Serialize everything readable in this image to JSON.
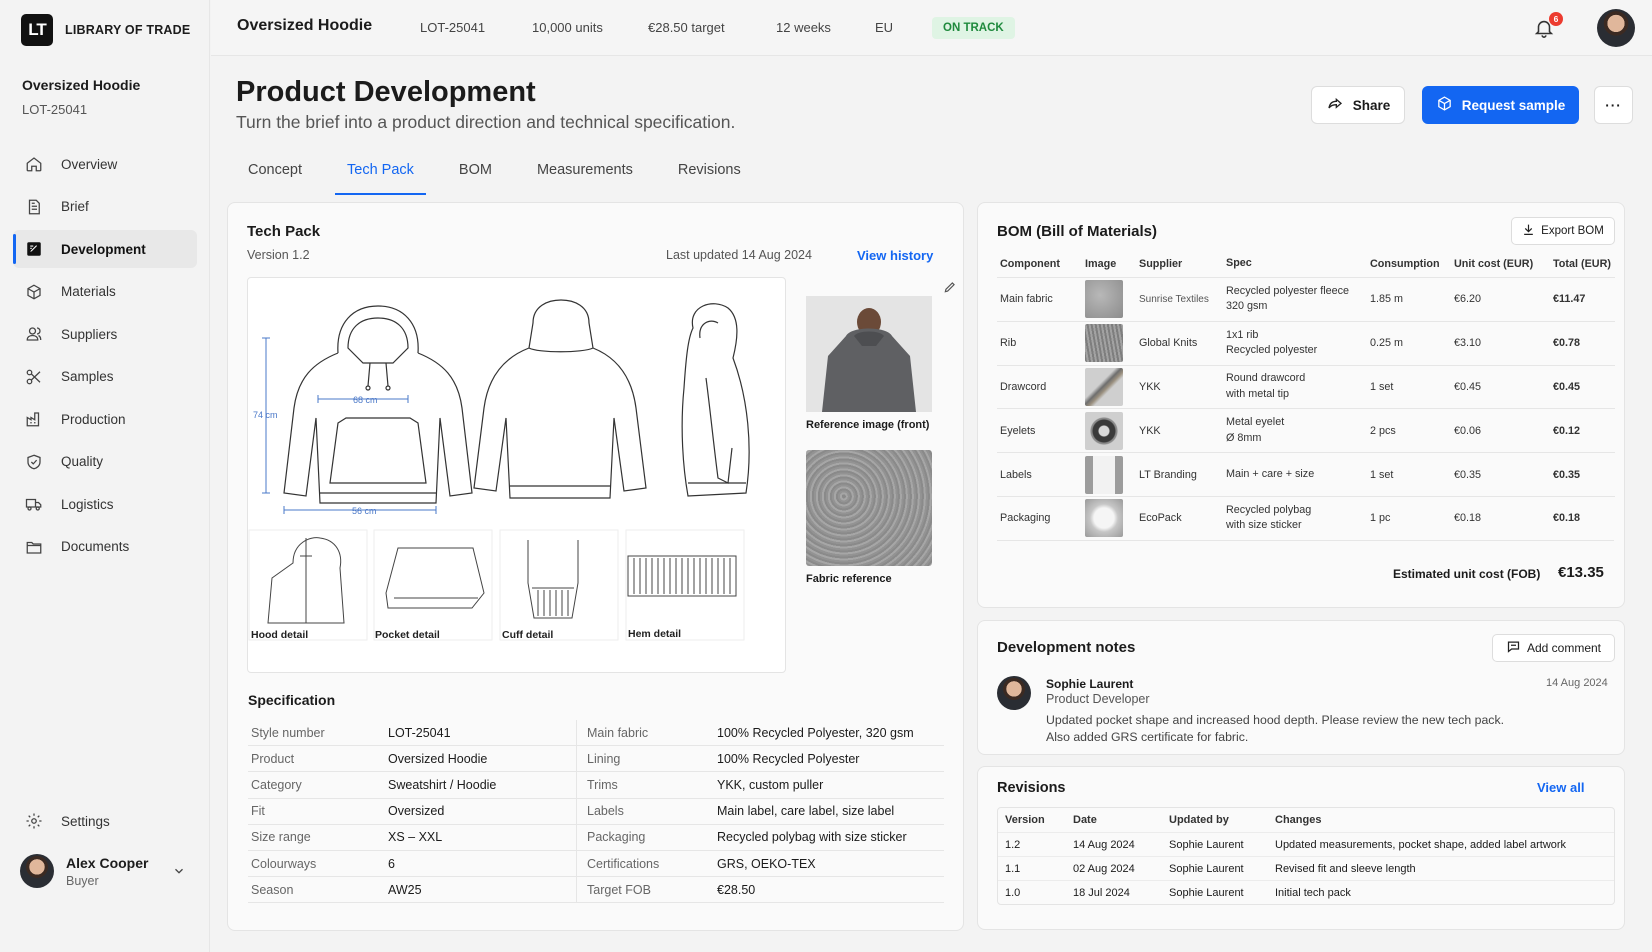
{
  "brand": {
    "logo": "LT",
    "name": "LIBRARY OF TRADE"
  },
  "product": {
    "name": "Oversized Hoodie",
    "code": "LOT-25041"
  },
  "nav": [
    {
      "label": "Overview",
      "icon": "home-icon"
    },
    {
      "label": "Brief",
      "icon": "document-icon"
    },
    {
      "label": "Development",
      "icon": "edit-board-icon",
      "active": true
    },
    {
      "label": "Materials",
      "icon": "cube-icon"
    },
    {
      "label": "Suppliers",
      "icon": "users-icon"
    },
    {
      "label": "Samples",
      "icon": "scissors-icon"
    },
    {
      "label": "Production",
      "icon": "factory-icon"
    },
    {
      "label": "Quality",
      "icon": "shield-check-icon"
    },
    {
      "label": "Logistics",
      "icon": "truck-icon"
    },
    {
      "label": "Documents",
      "icon": "folder-icon"
    }
  ],
  "settings": {
    "label": "Settings"
  },
  "user": {
    "name": "Alex Cooper",
    "role": "Buyer"
  },
  "topbar": {
    "title": "Oversized Hoodie",
    "code": "LOT-25041",
    "units": "10,000 units",
    "target": "€28.50 target",
    "weeks": "12 weeks",
    "region": "EU",
    "status": "ON TRACK",
    "notifications": "6",
    "status_color": "#1f8a3d"
  },
  "page": {
    "title": "Product Development",
    "subtitle": "Turn the brief into a product direction and technical specification.",
    "share": "Share",
    "request_sample": "Request sample",
    "more": "···"
  },
  "tabs": [
    "Concept",
    "Tech Pack",
    "BOM",
    "Measurements",
    "Revisions"
  ],
  "techpack": {
    "title": "Tech Pack",
    "version": "Version 1.2",
    "updated": "Last updated 14 Aug 2024",
    "history": "View history",
    "dims": {
      "width": "68 cm",
      "length": "74 cm",
      "hem": "56 cm"
    },
    "details": [
      "Hood detail",
      "Pocket detail",
      "Cuff detail",
      "Hem detail"
    ],
    "ref_front": "Reference image (front)",
    "ref_fabric": "Fabric reference"
  },
  "spec": {
    "title": "Specification",
    "rows": [
      [
        "Style number",
        "LOT-25041",
        "Main fabric",
        "100% Recycled Polyester, 320 gsm"
      ],
      [
        "Product",
        "Oversized Hoodie",
        "Lining",
        "100% Recycled Polyester"
      ],
      [
        "Category",
        "Sweatshirt / Hoodie",
        "Trims",
        "YKK, custom puller"
      ],
      [
        "Fit",
        "Oversized",
        "Labels",
        "Main label, care label, size label"
      ],
      [
        "Size range",
        "XS – XXL",
        "Packaging",
        "Recycled polybag with size sticker"
      ],
      [
        "Colourways",
        "6",
        "Certifications",
        "GRS, OEKO-TEX"
      ],
      [
        "Season",
        "AW25",
        "Target FOB",
        "€28.50"
      ]
    ]
  },
  "bom": {
    "title": "BOM (Bill of Materials)",
    "export": "Export BOM",
    "headers": [
      "Component",
      "Image",
      "Supplier",
      "Spec",
      "Consumption",
      "Unit cost (EUR)",
      "Total (EUR)"
    ],
    "rows": [
      {
        "component": "Main fabric",
        "supplier": "Sunrise Textiles",
        "spec1": "Recycled polyester fleece",
        "spec2": "320 gsm",
        "consumption": "1.85 m",
        "unit": "€6.20",
        "total": "€11.47",
        "thumb": "fleece"
      },
      {
        "component": "Rib",
        "supplier": "Global Knits",
        "spec1": "1x1 rib",
        "spec2": "Recycled polyester",
        "consumption": "0.25 m",
        "unit": "€3.10",
        "total": "€0.78",
        "thumb": "rib"
      },
      {
        "component": "Drawcord",
        "supplier": "YKK",
        "spec1": "Round drawcord",
        "spec2": "with metal tip",
        "consumption": "1 set",
        "unit": "€0.45",
        "total": "€0.45",
        "thumb": "cord"
      },
      {
        "component": "Eyelets",
        "supplier": "YKK",
        "spec1": "Metal eyelet",
        "spec2": "Ø 8mm",
        "consumption": "2 pcs",
        "unit": "€0.06",
        "total": "€0.12",
        "thumb": "eyelet"
      },
      {
        "component": "Labels",
        "supplier": "LT Branding",
        "spec1": "Main + care + size",
        "spec2": "",
        "consumption": "1 set",
        "unit": "€0.35",
        "total": "€0.35",
        "thumb": "label"
      },
      {
        "component": "Packaging",
        "supplier": "EcoPack",
        "spec1": "Recycled polybag",
        "spec2": "with size sticker",
        "consumption": "1 pc",
        "unit": "€0.18",
        "total": "€0.18",
        "thumb": "bag"
      }
    ],
    "total_label": "Estimated unit cost (FOB)",
    "total_value": "€13.35"
  },
  "notes": {
    "title": "Development notes",
    "add": "Add comment",
    "author": "Sophie Laurent",
    "role": "Product Developer",
    "date": "14 Aug 2024",
    "text1": "Updated pocket shape and increased hood depth. Please review the new tech pack.",
    "text2": "Also added GRS certificate for fabric."
  },
  "revisions": {
    "title": "Revisions",
    "view_all": "View all",
    "headers": [
      "Version",
      "Date",
      "Updated by",
      "Changes"
    ],
    "rows": [
      [
        "1.2",
        "14 Aug 2024",
        "Sophie Laurent",
        "Updated measurements, pocket shape, added label artwork"
      ],
      [
        "1.1",
        "02 Aug 2024",
        "Sophie Laurent",
        "Revised fit and sleeve length"
      ],
      [
        "1.0",
        "18 Jul 2024",
        "Sophie Laurent",
        "Initial tech pack"
      ]
    ]
  },
  "colors": {
    "accent": "#1366f2",
    "success_bg": "#dff4e4",
    "notification": "#ec3b2f"
  }
}
